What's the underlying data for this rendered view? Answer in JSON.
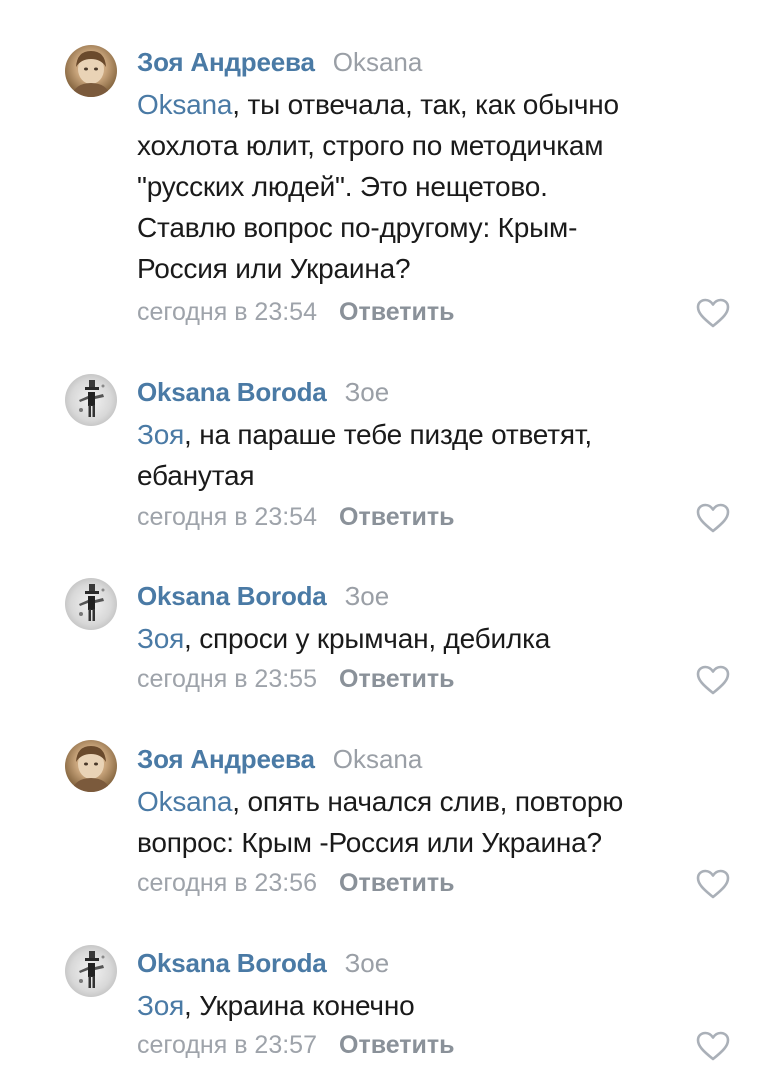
{
  "comments": [
    {
      "author": "Зоя Андреева",
      "reply_to": "Oksana",
      "mention": "Oksana",
      "text_lines": [
        ", ты отвечала, так, как обычно",
        "хохлота юлит, строго по методичкам",
        "\"русских людей\". Это нещетово.",
        "Ставлю вопрос по-другому: Крым-",
        "Россия или Украина?"
      ],
      "time": "сегодня в 23:54",
      "reply_label": "Ответить"
    },
    {
      "author": "Oksana Boroda",
      "reply_to": "Зое",
      "mention": "Зоя",
      "text_lines": [
        ", на параше тебе пизде ответят,",
        "ебанутая"
      ],
      "time": "сегодня в 23:54",
      "reply_label": "Ответить"
    },
    {
      "author": "Oksana Boroda",
      "reply_to": "Зое",
      "mention": "Зоя",
      "text_lines": [
        ", спроси у крымчан, дебилка"
      ],
      "time": "сегодня в 23:55",
      "reply_label": "Ответить"
    },
    {
      "author": "Зоя Андреева",
      "reply_to": "Oksana",
      "mention": "Oksana",
      "text_lines": [
        ", опять начался слив, повторю",
        "вопрос: Крым -Россия или Украина?"
      ],
      "time": "сегодня в 23:56",
      "reply_label": "Ответить"
    },
    {
      "author": "Oksana Boroda",
      "reply_to": "Зое",
      "mention": "Зоя",
      "text_lines": [
        ", Украина конечно"
      ],
      "time": "сегодня в 23:57",
      "reply_label": "Ответить"
    }
  ],
  "icons": {
    "like": "heart-outline-icon"
  },
  "colors": {
    "author": "#4a7aa5",
    "mention": "#4a7aa5",
    "meta": "#9ea3aa",
    "text": "#1a1a1a",
    "like_icon": "#aab0b8"
  }
}
